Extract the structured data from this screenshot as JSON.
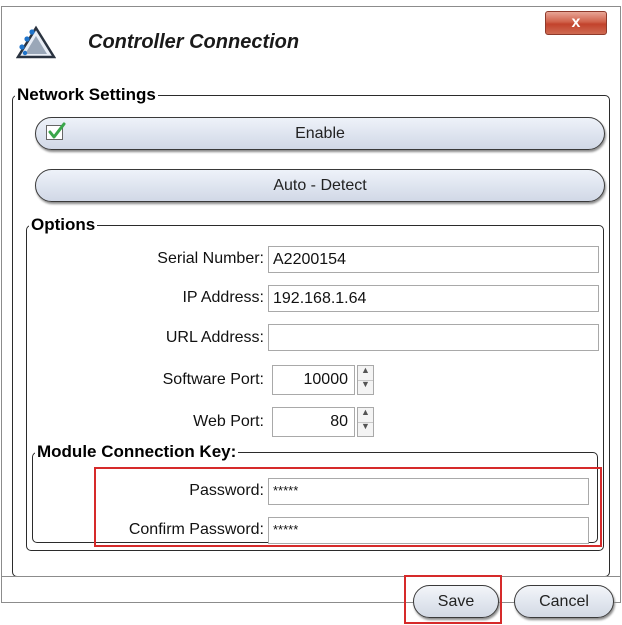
{
  "window": {
    "title": "Controller Connection",
    "close_label": "x"
  },
  "network_settings": {
    "legend": "Network Settings",
    "enable_label": "Enable",
    "enable_checked": true,
    "auto_detect_label": "Auto - Detect"
  },
  "options": {
    "legend": "Options",
    "serial_number": {
      "label": "Serial Number:",
      "value": "A2200154"
    },
    "ip_address": {
      "label": "IP Address:",
      "value": "192.168.1.64"
    },
    "url_address": {
      "label": "URL Address:",
      "value": ""
    },
    "software_port": {
      "label": "Software Port:",
      "value": "10000"
    },
    "web_port": {
      "label": "Web Port:",
      "value": "80"
    }
  },
  "module_key": {
    "legend": "Module Connection Key:",
    "password": {
      "label": "Password:",
      "value": "*****"
    },
    "confirm_password": {
      "label": "Confirm Password:",
      "value": "*****"
    }
  },
  "footer": {
    "save_label": "Save",
    "cancel_label": "Cancel"
  },
  "colors": {
    "highlight": "#d62a2a",
    "close_button": "#c2432c",
    "checkbox_check": "#3aa64a"
  }
}
